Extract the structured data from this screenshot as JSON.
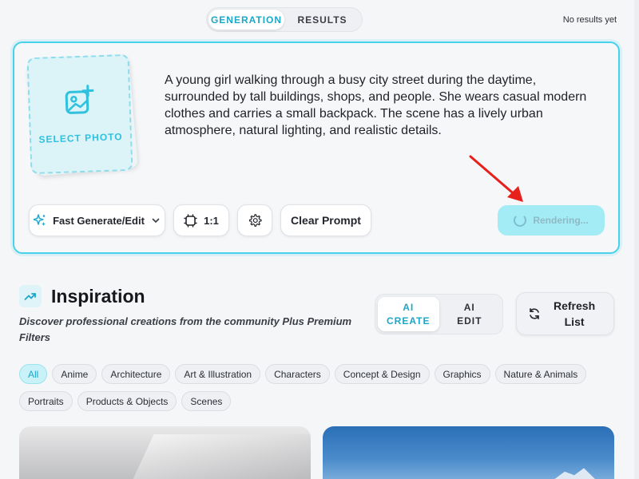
{
  "tabs": [
    {
      "label": "GENERATION",
      "active": true
    },
    {
      "label": "RESULTS",
      "active": false
    }
  ],
  "results_status": "No results yet",
  "generator": {
    "select_photo_label": "SELECT PHOTO",
    "prompt": "A young girl walking through a busy city street during the daytime, surrounded by tall buildings, shops, and people. She wears casual modern clothes and carries a small backpack. The scene has a lively urban atmosphere, natural lighting, and realistic details.",
    "mode_label": "Fast Generate/Edit",
    "aspect_ratio": "1:1",
    "clear_label": "Clear Prompt",
    "render_label": "Rendering..."
  },
  "inspiration": {
    "title": "Inspiration",
    "subtitle": "Discover professional creations from the community Plus Premium Filters",
    "mode_options": [
      {
        "line1": "AI",
        "line2": "CREATE",
        "active": true
      },
      {
        "line1": "AI",
        "line2": "EDIT",
        "active": false
      }
    ],
    "refresh": {
      "line1": "Refresh",
      "line2": "List"
    },
    "categories": [
      "All",
      "Anime",
      "Architecture",
      "Art & Illustration",
      "Characters",
      "Concept & Design",
      "Graphics",
      "Nature & Animals",
      "Portraits",
      "Products & Objects",
      "Scenes"
    ],
    "active_category": "All"
  },
  "colors": {
    "accent": "#1aa7c9",
    "card_border": "#45d2ea",
    "arrow": "#e8201c"
  },
  "icons": [
    "add-photo-icon",
    "sparkle-icon",
    "chevron-down-icon",
    "aspect-ratio-icon",
    "gear-icon",
    "spinner-icon",
    "trending-up-icon",
    "refresh-icon"
  ]
}
